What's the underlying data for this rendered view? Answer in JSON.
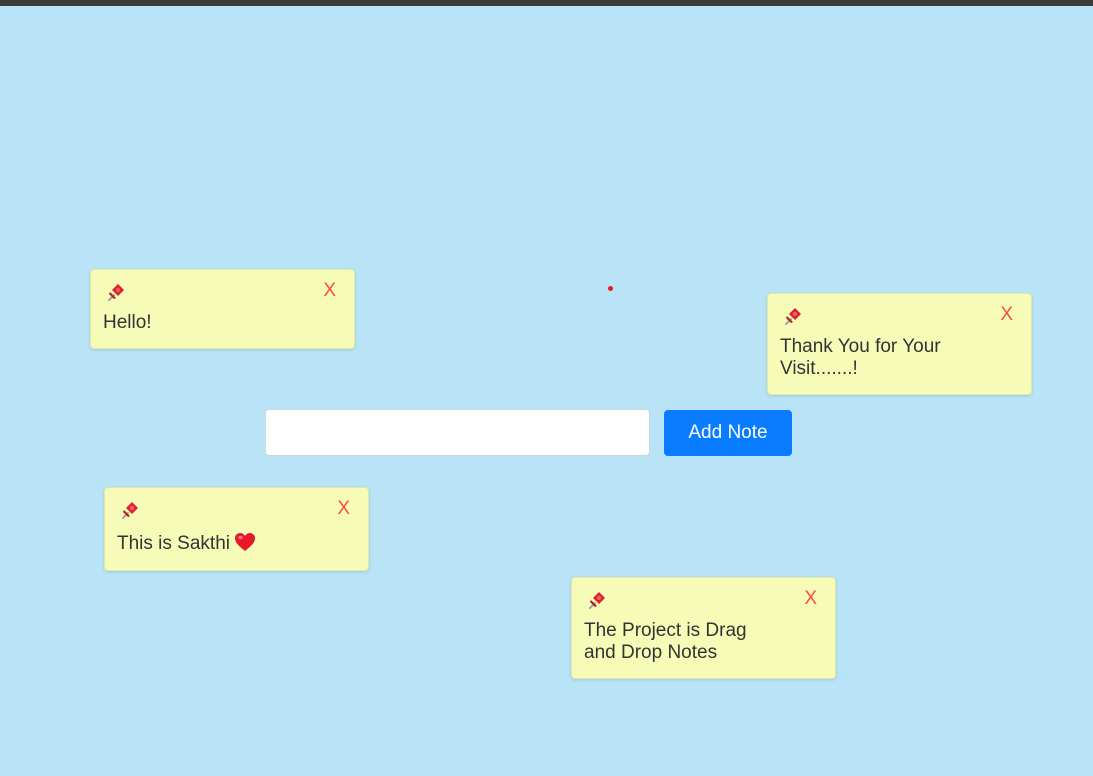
{
  "input": {
    "value": "",
    "placeholder": ""
  },
  "add_button_label": "Add Note",
  "notes": [
    {
      "text": "Hello!",
      "close_label": "X",
      "emoji": ""
    },
    {
      "text": "Thank You for Your Visit.......!",
      "close_label": "X",
      "emoji": ""
    },
    {
      "text": "This is Sakthi",
      "close_label": "X",
      "emoji": "heart-icon"
    },
    {
      "text": "The Project is Drag and Drop Notes",
      "close_label": "X",
      "emoji": ""
    }
  ],
  "icons": {
    "pin": "pushpin-icon",
    "heart": "heart-icon"
  },
  "colors": {
    "background": "#b9e3f7",
    "note": "#f6fcb8",
    "close": "#ff4d3a",
    "button": "#0a7cff",
    "heart": "#e8192c"
  }
}
